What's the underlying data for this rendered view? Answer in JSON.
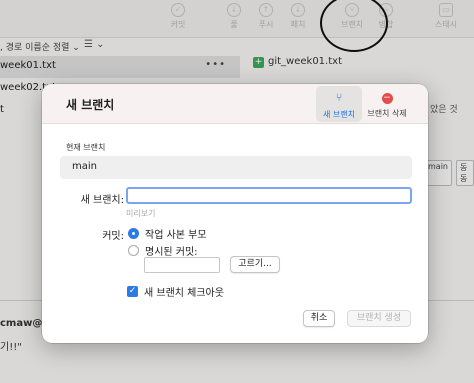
{
  "toolbar": {
    "items": [
      {
        "label": "커밋",
        "icon": "commit-icon",
        "glyph": "✓"
      },
      {
        "label": "풀",
        "icon": "pull-icon",
        "glyph": "↓"
      },
      {
        "label": "푸시",
        "icon": "push-icon",
        "glyph": "↑"
      },
      {
        "label": "패치",
        "icon": "fetch-icon",
        "glyph": "↓"
      },
      {
        "label": "브랜치",
        "icon": "branch-icon",
        "glyph": "⑂"
      },
      {
        "label": "병합",
        "icon": "merge-icon",
        "glyph": "⑃"
      },
      {
        "label": "스태시",
        "icon": "stash-icon",
        "glyph": "▭"
      }
    ]
  },
  "filter": {
    "label": ", 경로 이름순 정렬",
    "chevron": "⌄",
    "menu_icon": "☰ ⌄"
  },
  "files": [
    {
      "name": "week01.txt",
      "more": "•••"
    },
    {
      "name": "week02.txt"
    },
    {
      "name": "t"
    }
  ],
  "right_pane": {
    "file_title": "git_week01.txt",
    "badge": "+",
    "fragment": "았은 것",
    "chips": [
      "main",
      "동동"
    ]
  },
  "bottom": {
    "author_fragment": "cmaw@",
    "message_fragment": "기!!\""
  },
  "dialog": {
    "title": "새 브랜치",
    "tabs": [
      {
        "label": "새 브랜치",
        "icon": "branch-icon",
        "glyph": "⑂",
        "active": true
      },
      {
        "label": "브랜치 삭제",
        "icon": "delete-icon",
        "glyph": "−",
        "active": false
      }
    ],
    "current_branch_label": "현재 브랜치",
    "current_branch_value": "main",
    "new_branch_label": "새 브랜치:",
    "new_branch_value": "",
    "preview_label": "미리보기",
    "commit_label": "커밋:",
    "commit_options": [
      {
        "label": "작업 사본 부모",
        "selected": true
      },
      {
        "label": "명시된 커밋:",
        "selected": false
      }
    ],
    "specified_commit_value": "",
    "choose_button": "고르기...",
    "checkout_label": "새 브랜치 체크아웃",
    "checkout_checked": true,
    "cancel_button": "취소",
    "create_button": "브랜치 생성"
  },
  "colors": {
    "accent": "#2c7ae6",
    "delete": "#e44b4b",
    "add_badge": "#3aa657"
  }
}
